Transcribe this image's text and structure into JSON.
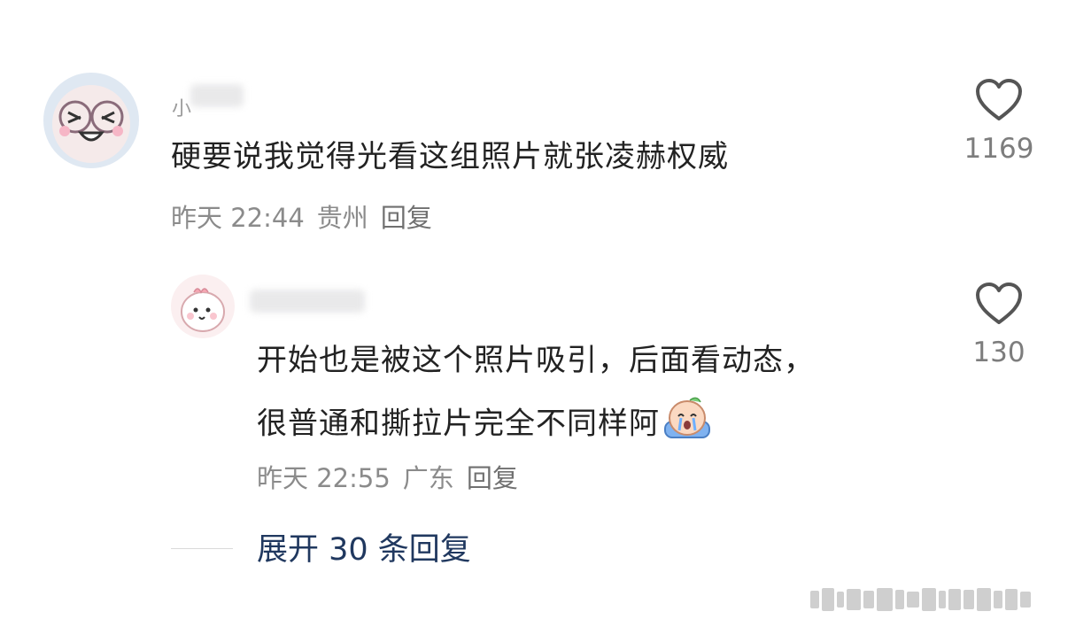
{
  "comments": [
    {
      "username": "小",
      "content": "硬要说我觉得光看这组照片就张凌赫权威",
      "time": "昨天 22:44",
      "location": "贵州",
      "reply_label": "回复",
      "likes": "1169",
      "avatar_icon": "cute-face-with-glasses-avatar"
    },
    {
      "username": "",
      "content_line1": "开始也是被这个照片吸引，后面看动态，",
      "content_line2": "很普通和撕拉片完全不同样阿",
      "emoji": "crying-emoji",
      "time": "昨天 22:55",
      "location": "广东",
      "reply_label": "回复",
      "likes": "130",
      "avatar_icon": "pink-dino-avatar"
    }
  ],
  "expand_replies_label": "展开 30 条回复",
  "colors": {
    "text": "#222222",
    "meta": "#8b8b8b",
    "link": "#20385f",
    "icon": "#555555"
  }
}
